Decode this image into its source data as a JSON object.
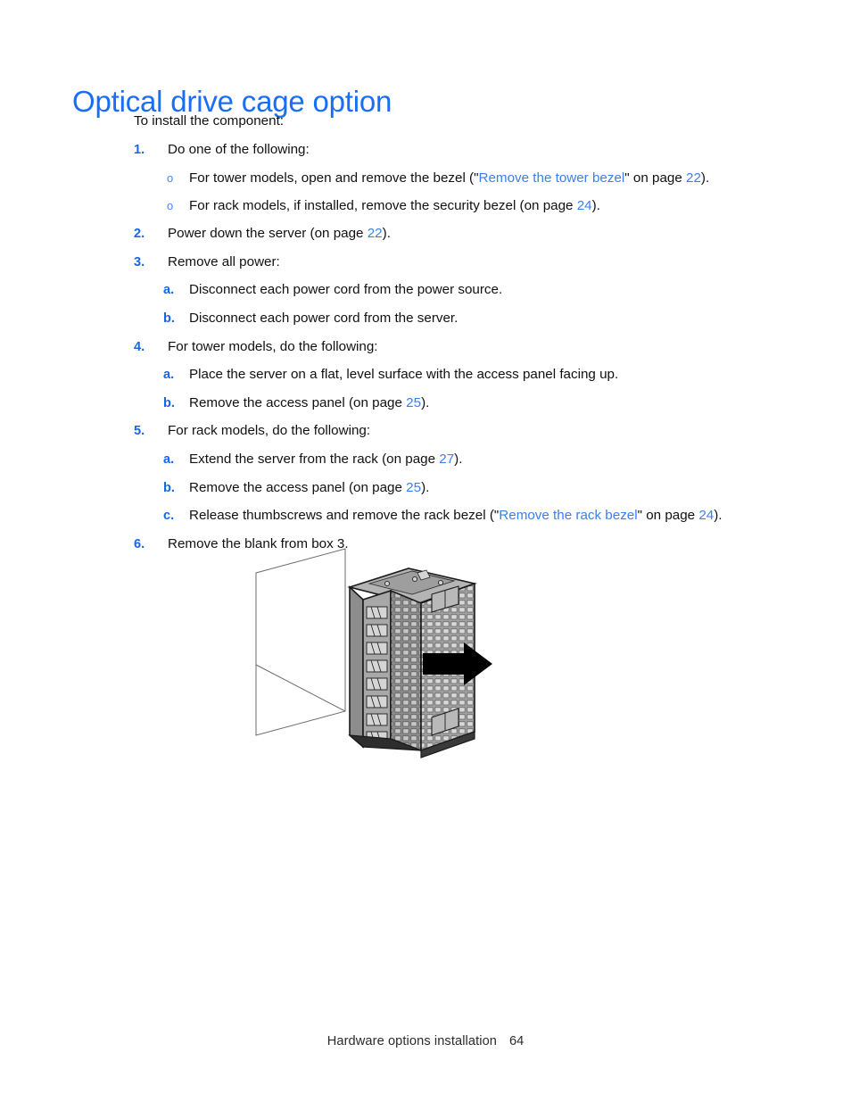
{
  "document": {
    "heading": "Optical drive cage option",
    "intro": "To install the component:",
    "footer": {
      "section": "Hardware options installation",
      "page_number": "64"
    },
    "colors": {
      "heading_blue": "#1a6ef5",
      "marker_blue": "#1667e8",
      "link_blue": "#3a7ff0",
      "bullet_blue": "#4a86ee",
      "body_text": "#111111",
      "illustration_gray": "#9a9a9a"
    }
  },
  "steps": [
    {
      "marker": "1.",
      "text": "Do one of the following:",
      "substeps": [
        {
          "marker": "o",
          "pre": "For tower models, open and remove the bezel (\"",
          "link": "Remove the tower bezel",
          "mid": "\" on page ",
          "page": "22",
          "post": ")."
        },
        {
          "marker": "o",
          "pre": "For rack models, if installed, remove the security bezel (on page ",
          "page": "24",
          "post": ")."
        }
      ]
    },
    {
      "marker": "2.",
      "pre": "Power down the server (on page ",
      "page": "22",
      "post": ")."
    },
    {
      "marker": "3.",
      "text": "Remove all power:",
      "substeps": [
        {
          "marker": "a.",
          "text": "Disconnect each power cord from the power source."
        },
        {
          "marker": "b.",
          "text": "Disconnect each power cord from the server."
        }
      ]
    },
    {
      "marker": "4.",
      "text": "For tower models, do the following:",
      "substeps": [
        {
          "marker": "a.",
          "text": "Place the server on a flat, level surface with the access panel facing up."
        },
        {
          "marker": "b.",
          "pre": "Remove the access panel (on page ",
          "page": "25",
          "post": ")."
        }
      ]
    },
    {
      "marker": "5.",
      "text": "For rack models, do the following:",
      "substeps": [
        {
          "marker": "a.",
          "pre": "Extend the server from the rack (on page ",
          "page": "27",
          "post": ")."
        },
        {
          "marker": "b.",
          "pre": "Remove the access panel (on page ",
          "page": "25",
          "post": ")."
        },
        {
          "marker": "c.",
          "pre": "Release thumbscrews and remove the rack bezel (\"",
          "link": "Remove the rack bezel",
          "mid": "\" on page ",
          "page": "24",
          "post": ")."
        }
      ]
    },
    {
      "marker": "6.",
      "text": "Remove the blank from box 3."
    }
  ],
  "figure": {
    "caption": "",
    "description": "Isometric line drawing of an optical drive blank being removed from a server bay, with a black arrow indicating the pull-out direction"
  }
}
